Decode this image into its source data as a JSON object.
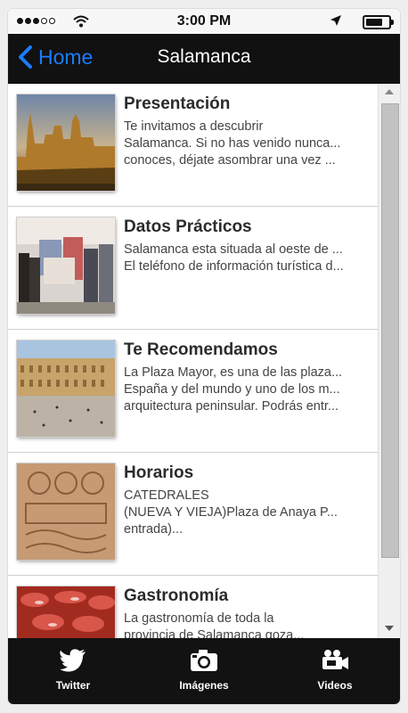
{
  "status": {
    "time": "3:00 PM"
  },
  "nav": {
    "back_label": "Home",
    "title": "Salamanca"
  },
  "items": [
    {
      "title": "Presentación",
      "lines": [
        "Te invitamos a descubrir",
        "Salamanca. Si no has venido nunca...",
        "conoces, déjate asombrar una vez ..."
      ]
    },
    {
      "title": "Datos Prácticos",
      "lines": [
        "Salamanca esta situada al oeste de ...",
        "El teléfono de información turística d..."
      ]
    },
    {
      "title": "Te Recomendamos",
      "lines": [
        "La Plaza Mayor, es una de las plaza...",
        "España y del mundo y uno de los m...",
        "arquitectura peninsular. Podrás entr..."
      ]
    },
    {
      "title": "Horarios",
      "lines": [
        "CATEDRALES",
        "(NUEVA Y VIEJA)Plaza de Anaya P...",
        "entrada)..."
      ]
    },
    {
      "title": "Gastronomía",
      "lines": [
        "La gastronomía de toda la",
        "provincia de Salamanca goza..."
      ]
    }
  ],
  "tabs": [
    {
      "label": "Twitter",
      "icon": "twitter-bird-icon"
    },
    {
      "label": "Imágenes",
      "icon": "camera-icon"
    },
    {
      "label": "Videos",
      "icon": "video-camera-icon"
    }
  ]
}
